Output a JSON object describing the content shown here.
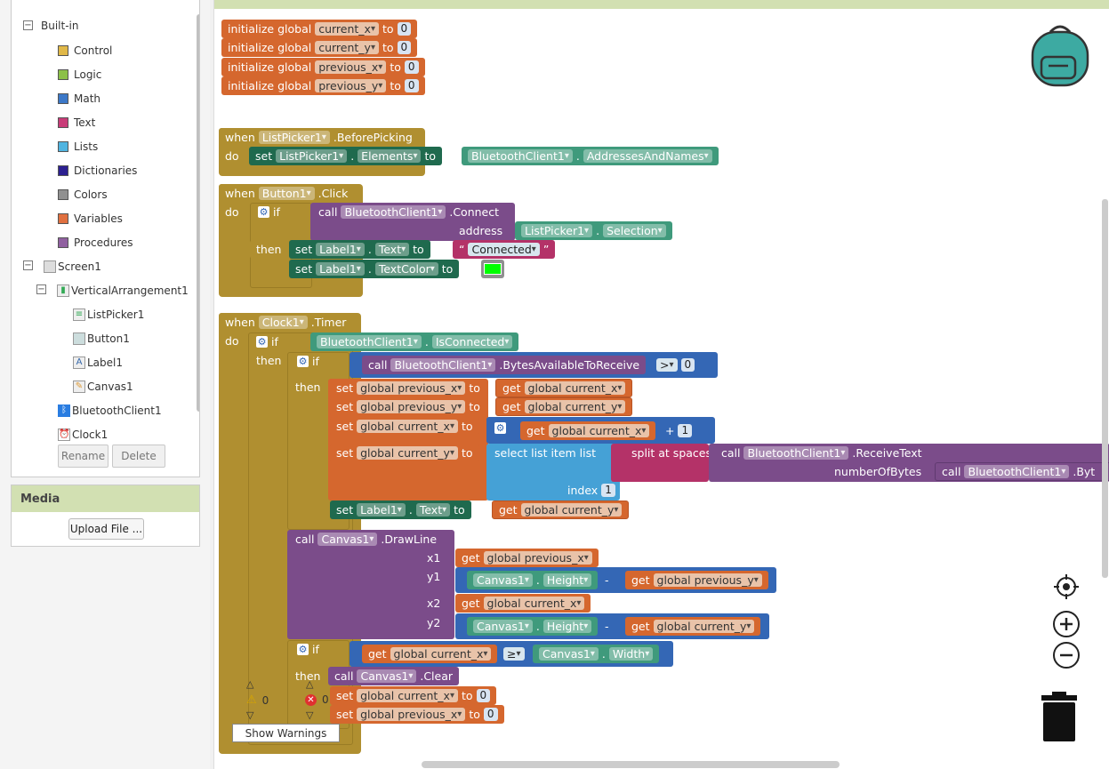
{
  "palette": {
    "builtin_label": "Built-in",
    "categories": [
      {
        "label": "Control",
        "color": "#e0b848"
      },
      {
        "label": "Logic",
        "color": "#8cc048"
      },
      {
        "label": "Math",
        "color": "#3c78c8"
      },
      {
        "label": "Text",
        "color": "#c83c78"
      },
      {
        "label": "Lists",
        "color": "#50b4e0"
      },
      {
        "label": "Dictionaries",
        "color": "#2c2090"
      },
      {
        "label": "Colors",
        "color": "#909090"
      },
      {
        "label": "Variables",
        "color": "#e07040"
      },
      {
        "label": "Procedures",
        "color": "#9060a0"
      }
    ],
    "screen_label": "Screen1",
    "vertical_label": "VerticalArrangement1",
    "components": [
      "ListPicker1",
      "Button1",
      "Label1",
      "Canvas1"
    ],
    "bluetooth_label": "BluetoothClient1",
    "clock_label": "Clock1",
    "rename_label": "Rename",
    "delete_label": "Delete"
  },
  "media": {
    "title": "Media",
    "upload_label": "Upload File ..."
  },
  "globals": [
    {
      "name": "current_x",
      "value": "0"
    },
    {
      "name": "current_y",
      "value": "0"
    },
    {
      "name": "previous_x",
      "value": "0"
    },
    {
      "name": "previous_y",
      "value": "0"
    }
  ],
  "kw": {
    "init": "initialize global",
    "to": "to",
    "when": "when",
    "do": "do",
    "set": "set",
    "call": "call",
    "if": "if",
    "then": "then",
    "get": "get",
    "address": "address",
    "index": "index",
    "numberOfBytes": "numberOfBytes",
    "select_list_item": "select list item  list",
    "split_at_spaces": "split at spaces",
    "x1": "x1",
    "y1": "y1",
    "x2": "x2",
    "y2": "y2",
    "plus": "+",
    "minus": "-",
    "gt": ">",
    "ge": "≥",
    "dot": "."
  },
  "blocks": {
    "listpicker": "ListPicker1",
    "beforepicking": ".BeforePicking",
    "elements": "Elements",
    "bt": "BluetoothClient1",
    "addr_names": "AddressesAndNames",
    "button": "Button1",
    "click": ".Click",
    "connect": ".Connect",
    "selection": "Selection",
    "label": "Label1",
    "text_prop": "Text",
    "textcolor": "TextColor",
    "connected": "Connected",
    "clock": "Clock1",
    "timer": ".Timer",
    "isconnected": "IsConnected",
    "bytesavail": ".BytesAvailableToReceive",
    "zero": "0",
    "one": "1",
    "g_prev_x": "global previous_x",
    "g_prev_y": "global previous_y",
    "g_cur_x": "global current_x",
    "g_cur_y": "global current_y",
    "receivetext": ".ReceiveText",
    "byt": ".Byt",
    "canvas": "Canvas1",
    "drawline": ".DrawLine",
    "height": "Height",
    "width": "Width",
    "clear": ".Clear",
    "color_swatch": "#00ff00"
  },
  "warnings": {
    "warn_count": "0",
    "error_count": "0",
    "show_label": "Show Warnings"
  }
}
